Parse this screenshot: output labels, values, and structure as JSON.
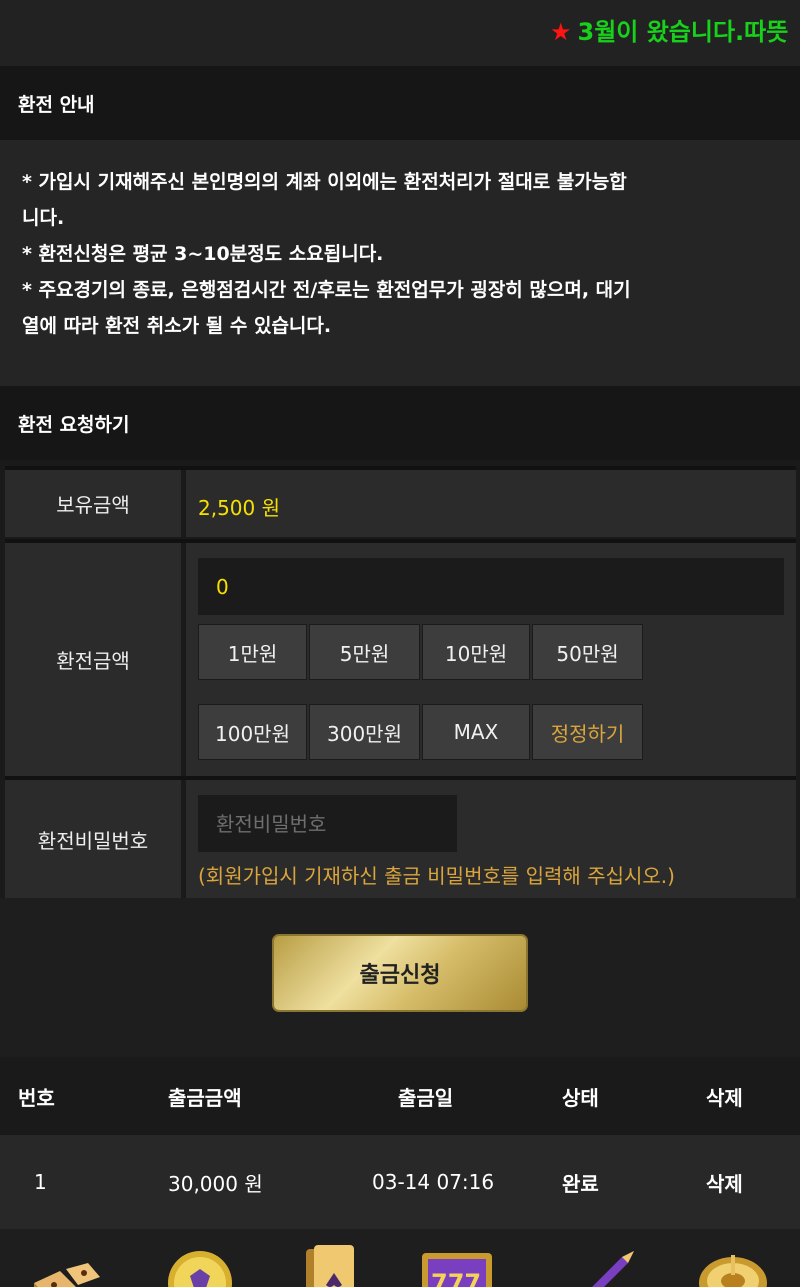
{
  "ticker": {
    "star": "★",
    "text": "3월이 왔습니다.따뜻"
  },
  "notice": {
    "title": "환전 안내",
    "lines": [
      "* 가입시 기재해주신 본인명의의 계좌 이외에는 환전처리가 절대로 불가능합",
      "니다.",
      "* 환전신청은 평균 3~10분정도 소요됩니다.",
      "* 주요경기의 종료, 은행점검시간 전/후로는 환전업무가 굉장히 많으며, 대기",
      "열에 따라 환전 취소가 될 수 있습니다."
    ]
  },
  "form": {
    "title": "환전 요청하기",
    "balance_label": "보유금액",
    "balance_value": "2,500 원",
    "amount_label": "환전금액",
    "amount_value": "0",
    "amount_buttons": [
      "1만원",
      "5만원",
      "10만원",
      "50만원",
      "100만원",
      "300만원",
      "MAX"
    ],
    "reset_button": "정정하기",
    "password_label": "환전비밀번호",
    "password_placeholder": "환전비밀번호",
    "password_hint": "(회원가입시 기재하신 출금 비밀번호를 입력해 주십시오.)",
    "submit": "출금신청"
  },
  "history": {
    "headers": [
      "번호",
      "출금금액",
      "출금일",
      "상태",
      "삭제"
    ],
    "rows": [
      {
        "no": "1",
        "amount": "30,000 원",
        "date": "03-14 07:16",
        "status": "완료",
        "delete": "삭제"
      }
    ]
  },
  "footer_icons": [
    "dice-icon",
    "soccer-ball-icon",
    "playing-cards-icon",
    "slot-machine-777-icon",
    "rocket-icon",
    "roulette-icon"
  ],
  "colors": {
    "accent_gold": "#d9a53c",
    "value_yellow": "#f5e000",
    "ticker_green": "#18d11b",
    "star_red": "#ff1414"
  }
}
